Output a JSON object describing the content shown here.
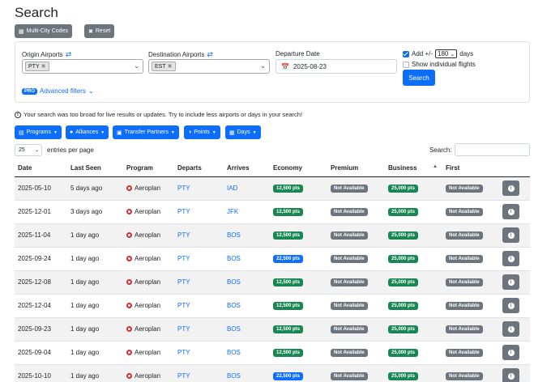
{
  "page": {
    "title": "Search"
  },
  "toolbar": {
    "multi_city_label": "Multi-City Codes",
    "reset_label": "Reset"
  },
  "form": {
    "origin_label": "Origin Airports",
    "origin_tags": [
      "PTY"
    ],
    "destination_label": "Destination Airports",
    "destination_tags": [
      "EST"
    ],
    "departure_label": "Departure Date",
    "departure_value": "2025-08-23",
    "add_days_prefix": "Add +/-",
    "add_days_value": "180",
    "add_days_suffix": "days",
    "show_individual_label": "Show individual flights",
    "search_button": "Search",
    "pro_badge": "PRO",
    "advanced_filters": "Advanced filters"
  },
  "notice": "Your search was too broad for live results or updates. Try to include less airports or days in your search!",
  "filters": [
    "Programs",
    "Alliances",
    "Transfer Partners",
    "Points",
    "Days"
  ],
  "entries": {
    "value": "25",
    "label": "entries per page"
  },
  "table_search_label": "Search:",
  "colors": {
    "primary": "#0d6efd",
    "success": "#198754",
    "secondary": "#6c757d"
  },
  "table": {
    "headers": [
      "Date",
      "Last Seen",
      "Program",
      "Departs",
      "Arrives",
      "Economy",
      "Premium",
      "Business",
      "First",
      ""
    ],
    "rows": [
      {
        "date": "2025-05-10",
        "last_seen": "5 days ago",
        "program": "Aeroplan",
        "departs": "PTY",
        "arrives": "IAD",
        "economy": "12,500 pts",
        "economy_color": "green",
        "premium": "Not Available",
        "business": "25,000 pts",
        "first": "Not Available"
      },
      {
        "date": "2025-12-01",
        "last_seen": "3 days ago",
        "program": "Aeroplan",
        "departs": "PTY",
        "arrives": "JFK",
        "economy": "12,500 pts",
        "economy_color": "green",
        "premium": "Not Available",
        "business": "25,000 pts",
        "first": "Not Available"
      },
      {
        "date": "2025-11-04",
        "last_seen": "1 day ago",
        "program": "Aeroplan",
        "departs": "PTY",
        "arrives": "BOS",
        "economy": "12,500 pts",
        "economy_color": "green",
        "premium": "Not Available",
        "business": "25,000 pts",
        "first": "Not Available"
      },
      {
        "date": "2025-09-24",
        "last_seen": "1 day ago",
        "program": "Aeroplan",
        "departs": "PTY",
        "arrives": "BOS",
        "economy": "22,500 pts",
        "economy_color": "blue",
        "premium": "Not Available",
        "business": "25,000 pts",
        "first": "Not Available"
      },
      {
        "date": "2025-12-08",
        "last_seen": "1 day ago",
        "program": "Aeroplan",
        "departs": "PTY",
        "arrives": "BOS",
        "economy": "12,500 pts",
        "economy_color": "green",
        "premium": "Not Available",
        "business": "25,000 pts",
        "first": "Not Available"
      },
      {
        "date": "2025-12-04",
        "last_seen": "1 day ago",
        "program": "Aeroplan",
        "departs": "PTY",
        "arrives": "BOS",
        "economy": "12,500 pts",
        "economy_color": "green",
        "premium": "Not Available",
        "business": "25,000 pts",
        "first": "Not Available"
      },
      {
        "date": "2025-09-23",
        "last_seen": "1 day ago",
        "program": "Aeroplan",
        "departs": "PTY",
        "arrives": "BOS",
        "economy": "12,500 pts",
        "economy_color": "green",
        "premium": "Not Available",
        "business": "25,000 pts",
        "first": "Not Available"
      },
      {
        "date": "2025-09-04",
        "last_seen": "1 day ago",
        "program": "Aeroplan",
        "departs": "PTY",
        "arrives": "BOS",
        "economy": "12,500 pts",
        "economy_color": "green",
        "premium": "Not Available",
        "business": "25,000 pts",
        "first": "Not Available"
      },
      {
        "date": "2025-10-10",
        "last_seen": "1 day ago",
        "program": "Aeroplan",
        "departs": "PTY",
        "arrives": "BOS",
        "economy": "22,500 pts",
        "economy_color": "blue",
        "premium": "Not Available",
        "business": "25,000 pts",
        "first": "Not Available"
      }
    ]
  }
}
